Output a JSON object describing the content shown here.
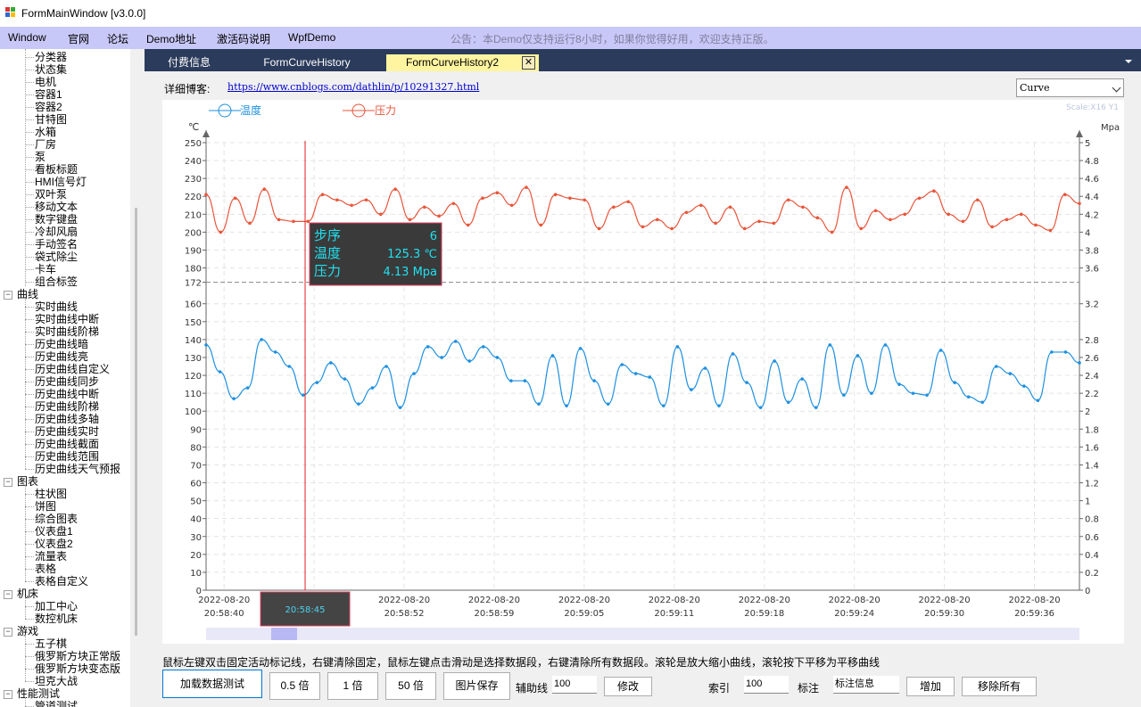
{
  "window": {
    "title": "FormMainWindow [v3.0.0]"
  },
  "menu": {
    "items": [
      "Window",
      "官网",
      "论坛",
      "Demo地址",
      "激活码说明",
      "WpfDemo"
    ],
    "notice": "公告：本Demo仅支持运行8小时，如果你觉得好用，欢迎支持正版。"
  },
  "tree": {
    "group1_items": [
      "分类器",
      "状态集",
      "电机",
      "容器1",
      "容器2",
      "甘特图",
      "水箱",
      "厂房",
      "泵",
      "看板标题",
      "HMI信号灯",
      "双叶泵",
      "移动文本",
      "数字键盘",
      "冷却风扇",
      "手动签名",
      "袋式除尘",
      "卡车",
      "组合标签"
    ],
    "curve_label": "曲线",
    "curve_items": [
      "实时曲线",
      "实时曲线中断",
      "实时曲线阶梯",
      "历史曲线暗",
      "历史曲线亮",
      "历史曲线自定义",
      "历史曲线同步",
      "历史曲线中断",
      "历史曲线阶梯",
      "历史曲线多轴",
      "历史曲线实时",
      "历史曲线截面",
      "历史曲线范围",
      "历史曲线天气预报"
    ],
    "chart_label": "图表",
    "chart_items": [
      "柱状图",
      "饼图",
      "综合图表",
      "仪表盘1",
      "仪表盘2",
      "流量表",
      "表格",
      "表格自定义"
    ],
    "machine_label": "机床",
    "machine_items": [
      "加工中心",
      "数控机床"
    ],
    "game_label": "游戏",
    "game_items": [
      "五子棋",
      "俄罗斯方块正常版",
      "俄罗斯方块变态版",
      "坦克大战"
    ],
    "perf_label": "性能测试",
    "perf_items": [
      "管道测试"
    ]
  },
  "tabs": [
    "付费信息",
    "FormCurveHistory",
    "FormCurveHistory2"
  ],
  "active_tab": "FormCurveHistory2",
  "blog": {
    "label": "详细博客:",
    "url": "https://www.cnblogs.com/dathlin/p/10291327.html"
  },
  "combo": {
    "value": "Curve"
  },
  "chart_data": {
    "type": "line",
    "legend": [
      "温度",
      "压力"
    ],
    "scale_label": "Scale:X16 Y1",
    "left_axis": {
      "unit": "℃",
      "range": [
        0,
        250
      ],
      "ticks": [
        0,
        10,
        20,
        30,
        40,
        50,
        60,
        70,
        80,
        90,
        100,
        110,
        120,
        130,
        140,
        150,
        160,
        172,
        180,
        190,
        200,
        210,
        220,
        230,
        240,
        250
      ]
    },
    "right_axis": {
      "unit": "Mpa",
      "range": [
        0,
        5
      ],
      "ticks": [
        "0",
        "0.2",
        "0.4",
        "0.6",
        "0.8",
        "1",
        "1.2",
        "1.4",
        "1.6",
        "1.8",
        "2",
        "2.2",
        "2.4",
        "2.6",
        "2.8",
        "3.2",
        "3.6",
        "3.8",
        "4",
        "4.2",
        "4.4",
        "4.6",
        "4.8",
        "5"
      ]
    },
    "reference_line": 172,
    "x_labels": [
      {
        "date": "2022-08-20",
        "time": "20:58:40"
      },
      {
        "date": "2022-08-20",
        "time": "20:58:46"
      },
      {
        "date": "2022-08-20",
        "time": "20:58:52"
      },
      {
        "date": "2022-08-20",
        "time": "20:58:59"
      },
      {
        "date": "2022-08-20",
        "time": "20:59:05"
      },
      {
        "date": "2022-08-20",
        "time": "20:59:11"
      },
      {
        "date": "2022-08-20",
        "time": "20:59:18"
      },
      {
        "date": "2022-08-20",
        "time": "20:59:24"
      },
      {
        "date": "2022-08-20",
        "time": "20:59:30"
      },
      {
        "date": "2022-08-20",
        "time": "20:59:36"
      }
    ],
    "cursor_time": "20:58:45",
    "series": [
      {
        "name": "温度",
        "color": "#1e90e0",
        "axis": "left",
        "values": [
          137,
          122,
          107,
          113,
          140,
          133,
          125,
          109,
          116,
          127,
          118,
          104,
          113,
          125,
          102,
          121,
          136,
          130,
          139,
          128,
          136,
          130,
          117,
          117,
          104,
          131,
          103,
          135,
          117,
          104,
          126,
          121,
          119,
          103,
          136,
          112,
          124,
          103,
          132,
          116,
          102,
          128,
          105,
          118,
          102,
          137,
          109,
          131,
          110,
          137,
          115,
          110,
          109,
          134,
          116,
          108,
          105,
          125,
          121,
          114,
          106,
          133,
          133,
          127
        ],
        "labels_visible": false
      },
      {
        "name": "压力",
        "color": "#e8553a",
        "axis": "right",
        "values": [
          4.42,
          4.0,
          4.38,
          4.1,
          4.48,
          4.14,
          4.12,
          4.12,
          4.42,
          4.36,
          4.3,
          4.36,
          4.2,
          4.48,
          4.14,
          4.28,
          4.18,
          4.32,
          4.08,
          4.38,
          4.44,
          4.3,
          4.5,
          4.08,
          4.42,
          4.38,
          4.36,
          4.04,
          4.28,
          4.34,
          4.06,
          4.14,
          4.04,
          4.22,
          4.3,
          4.1,
          4.28,
          4.04,
          4.12,
          4.1,
          4.36,
          4.28,
          4.16,
          4.0,
          4.5,
          4.04,
          4.24,
          4.14,
          4.2,
          4.38,
          4.46,
          4.2,
          4.12,
          4.36,
          4.06,
          4.14,
          4.2,
          4.08,
          4.02,
          4.42,
          4.32
        ],
        "labels_visible": false
      }
    ],
    "tooltip": {
      "rows": [
        [
          "步序",
          "6"
        ],
        [
          "温度",
          "125.3 ℃"
        ],
        [
          "压力",
          "4.13 Mpa"
        ]
      ]
    }
  },
  "hint": "鼠标左键双击固定活动标记线，右键清除固定，鼠标左键点击滑动是选择数据段，右键清除所有数据段。滚轮是放大缩小曲线，滚轮按下平移为平移曲线",
  "bottom": {
    "btn_load": "加载数据测试",
    "btn_half": "0.5 倍",
    "btn_one": "1 倍",
    "btn_fifty": "50 倍",
    "btn_save": "图片保存",
    "aux_label": "辅助线",
    "aux_value": "100",
    "btn_modify": "修改",
    "index_label": "索引",
    "index_value": "100",
    "mark_label": "标注",
    "mark_value": "标注信息",
    "btn_add": "增加",
    "btn_remove": "移除所有"
  }
}
